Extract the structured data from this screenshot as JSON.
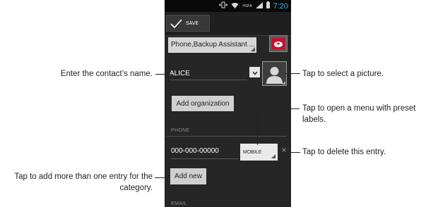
{
  "status_bar": {
    "time": "7:20",
    "network_label": "HSPA",
    "icons": [
      "vibrate-icon",
      "wifi-icon",
      "signal-icon",
      "battery-icon"
    ]
  },
  "action_bar": {
    "save_label": "SAVE"
  },
  "account": {
    "label": "Phone,Backup Assistant ..."
  },
  "contact": {
    "name_value": "ALICE"
  },
  "buttons": {
    "add_organization": "Add organization",
    "add_new": "Add new"
  },
  "sections": {
    "phone": "PHONE",
    "email": "EMAIL"
  },
  "phone_entry": {
    "number": "000-000-00000",
    "type_label": "MOBILE"
  },
  "annotations": {
    "enter_name": "Enter the contact’s name.",
    "select_picture": "Tap to select a picture.",
    "preset_labels": "Tap to open a menu with preset labels.",
    "delete_entry": "Tap to delete this entry.",
    "add_more": "Tap to add more than one entry for the category."
  },
  "colors": {
    "phone_bg": "#262626",
    "status_bar_bg": "#0a0a0a",
    "accent": "#33b5e5",
    "account_icon_red": "#c8102e"
  }
}
